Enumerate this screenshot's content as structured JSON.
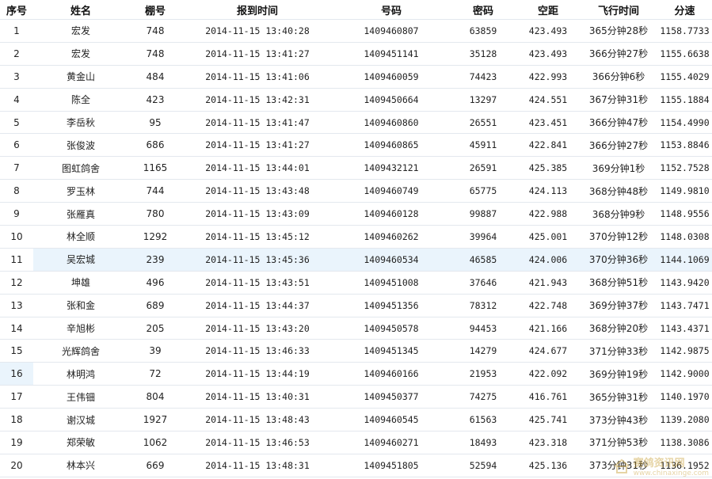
{
  "table": {
    "headers": [
      "序号",
      "姓名",
      "棚号",
      "报到时间",
      "号码",
      "密码",
      "空距",
      "飞行时间",
      "分速"
    ],
    "rows": [
      [
        "1",
        "宏发",
        "748",
        "2014-11-15 13:40:28",
        "1409460807",
        "63859",
        "423.493",
        "365分钟28秒",
        "1158.7733"
      ],
      [
        "2",
        "宏发",
        "748",
        "2014-11-15 13:41:27",
        "1409451141",
        "35128",
        "423.493",
        "366分钟27秒",
        "1155.6638"
      ],
      [
        "3",
        "黄金山",
        "484",
        "2014-11-15 13:41:06",
        "1409460059",
        "74423",
        "422.993",
        "366分钟6秒",
        "1155.4029"
      ],
      [
        "4",
        "陈全",
        "423",
        "2014-11-15 13:42:31",
        "1409450664",
        "13297",
        "424.551",
        "367分钟31秒",
        "1155.1884"
      ],
      [
        "5",
        "李岳秋",
        "95",
        "2014-11-15 13:41:47",
        "1409460860",
        "26551",
        "423.451",
        "366分钟47秒",
        "1154.4990"
      ],
      [
        "6",
        "张俊波",
        "686",
        "2014-11-15 13:41:27",
        "1409460865",
        "45911",
        "422.841",
        "366分钟27秒",
        "1153.8846"
      ],
      [
        "7",
        "图虹鸽舍",
        "1165",
        "2014-11-15 13:44:01",
        "1409432121",
        "26591",
        "425.385",
        "369分钟1秒",
        "1152.7528"
      ],
      [
        "8",
        "罗玉林",
        "744",
        "2014-11-15 13:43:48",
        "1409460749",
        "65775",
        "424.113",
        "368分钟48秒",
        "1149.9810"
      ],
      [
        "9",
        "张雁真",
        "780",
        "2014-11-15 13:43:09",
        "1409460128",
        "99887",
        "422.988",
        "368分钟9秒",
        "1148.9556"
      ],
      [
        "10",
        "林全顺",
        "1292",
        "2014-11-15 13:45:12",
        "1409460262",
        "39964",
        "425.001",
        "370分钟12秒",
        "1148.0308"
      ],
      [
        "11",
        "吴宏城",
        "239",
        "2014-11-15 13:45:36",
        "1409460534",
        "46585",
        "424.006",
        "370分钟36秒",
        "1144.1069"
      ],
      [
        "12",
        "坤雄",
        "496",
        "2014-11-15 13:43:51",
        "1409451008",
        "37646",
        "421.943",
        "368分钟51秒",
        "1143.9420"
      ],
      [
        "13",
        "张和金",
        "689",
        "2014-11-15 13:44:37",
        "1409451356",
        "78312",
        "422.748",
        "369分钟37秒",
        "1143.7471"
      ],
      [
        "14",
        "辛旭彬",
        "205",
        "2014-11-15 13:43:20",
        "1409450578",
        "94453",
        "421.166",
        "368分钟20秒",
        "1143.4371"
      ],
      [
        "15",
        "光辉鸽舍",
        "39",
        "2014-11-15 13:46:33",
        "1409451345",
        "14279",
        "424.677",
        "371分钟33秒",
        "1142.9875"
      ],
      [
        "16",
        "林明鸿",
        "72",
        "2014-11-15 13:44:19",
        "1409460166",
        "21953",
        "422.092",
        "369分钟19秒",
        "1142.9000"
      ],
      [
        "17",
        "王伟钿",
        "804",
        "2014-11-15 13:40:31",
        "1409450377",
        "74275",
        "416.761",
        "365分钟31秒",
        "1140.1970"
      ],
      [
        "18",
        "谢汉城",
        "1927",
        "2014-11-15 13:48:43",
        "1409460545",
        "61563",
        "425.741",
        "373分钟43秒",
        "1139.2080"
      ],
      [
        "19",
        "郑荣敏",
        "1062",
        "2014-11-15 13:46:53",
        "1409460271",
        "18493",
        "423.318",
        "371分钟53秒",
        "1138.3086"
      ],
      [
        "20",
        "林本兴",
        "669",
        "2014-11-15 13:48:31",
        "1409451805",
        "52594",
        "425.136",
        "373分钟31秒",
        "1136.1952"
      ]
    ],
    "highlighted_row_index": 10,
    "highlighted_rank_cell_index": 15,
    "highlight_color": "#eaf4fc"
  },
  "watermark": {
    "icon": "house-icon",
    "text": "赛鸽资讯网",
    "sub": "www.chinaxinge.com"
  }
}
